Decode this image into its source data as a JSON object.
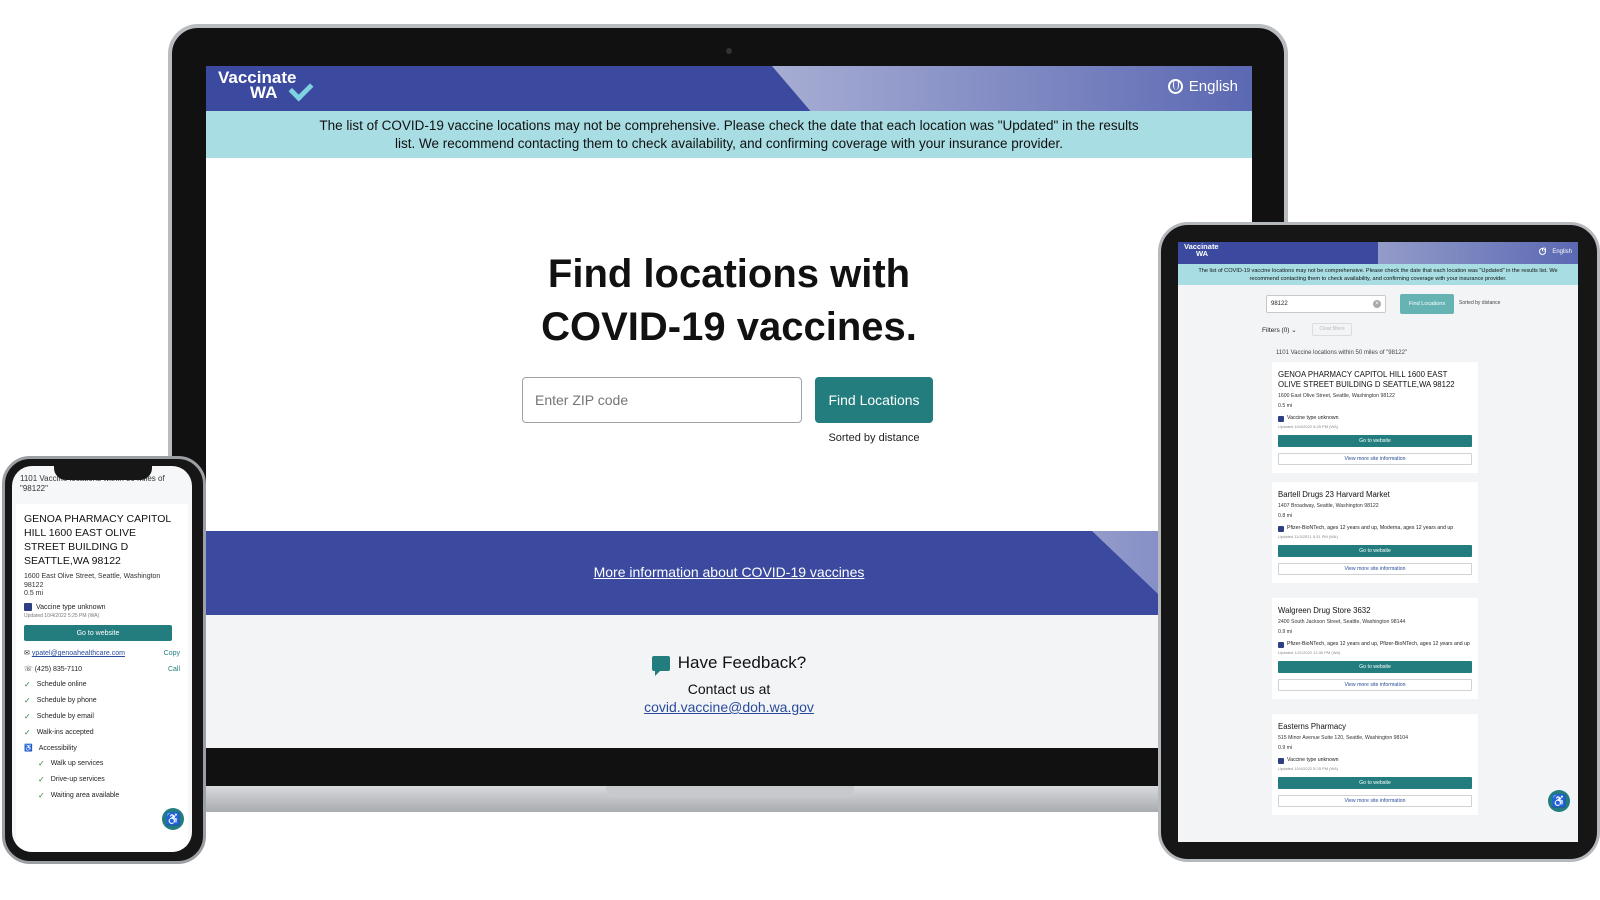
{
  "brand": {
    "logo_line1": "Vaccinate",
    "logo_line2": "WA",
    "language": "English",
    "icon_globe": "globe-icon",
    "icon_check": "check-icon",
    "colors": {
      "primary": "#3b4a9e",
      "banner": "#a8dde3",
      "button": "#237d7e"
    }
  },
  "laptop": {
    "banner": "The list of COVID-19 vaccine locations may not be comprehensive. Please check the date that each location was \"Updated\" in the results list. We recommend contacting them to check availability, and confirming coverage with your insurance provider.",
    "title_line1": "Find locations with",
    "title_line2": "COVID-19 vaccines.",
    "zip_placeholder": "Enter ZIP code",
    "find_button": "Find Locations",
    "sorted": "Sorted by distance",
    "more_info_link": "More information about COVID-19 vaccines",
    "feedback_title": "Have Feedback?",
    "feedback_contact": "Contact us at",
    "feedback_email": "covid.vaccine@doh.wa.gov"
  },
  "phone": {
    "result_count": "1101 Vaccine locations within 50 miles of \"98122\"",
    "card": {
      "name": "GENOA PHARMACY CAPITOL HILL 1600 EAST OLIVE STREET BUILDING D SEATTLE,WA 98122",
      "address": "1600 East Olive Street, Seattle, Washington 98122",
      "distance": "0.5 mi",
      "vaccine_type": "Vaccine type unknown",
      "updated": "Updated 10/4/2022 5:25 PM (WA)",
      "go_button": "Go to website",
      "email": "ypatel@genoahealthcare.com",
      "copy": "Copy",
      "phone": "(425) 835-7110",
      "call": "Call",
      "features": [
        "Schedule online",
        "Schedule by phone",
        "Schedule by email",
        "Walk-ins accepted"
      ],
      "accessibility_label": "Accessibility",
      "accessibility_items": [
        "Walk up services",
        "Drive-up services",
        "Waiting area available"
      ]
    },
    "accessibility_menu": "Accessibility Menu"
  },
  "tablet": {
    "banner": "The list of COVID-19 vaccine locations may not be comprehensive. Please check the date that each location was \"Updated\" in the results list. We recommend contacting them to check availability, and confirming coverage with your insurance provider.",
    "search_value": "98122",
    "find_button": "Find Locations",
    "sorted": "Sorted by distance",
    "filters": "Filters (0)",
    "clear_filters": "Clear filters",
    "result_count": "1101 Vaccine locations within 50 miles of \"98122\"",
    "go_button": "Go to website",
    "more_button": "View more site information",
    "cards": [
      {
        "name": "GENOA PHARMACY CAPITOL HILL 1600 EAST OLIVE STREET BUILDING D SEATTLE,WA 98122",
        "address": "1600 East Olive Street, Seattle, Washington 98122",
        "distance": "0.5 mi",
        "vaccine": "Vaccine type unknown",
        "updated": "Updated 10/4/2022 5:25 PM (WA)"
      },
      {
        "name": "Bartell Drugs 23 Harvard Market",
        "address": "1407 Broadway, Seattle, Washington 98122",
        "distance": "0.8 mi",
        "vaccine": "Pfizer-BioNTech, ages 12 years and up, Moderna, ages 12 years and up",
        "updated": "Updated 11/3/2021 5:31 PM (WA)"
      },
      {
        "name": "Walgreen Drug Store 3632",
        "address": "2400 South Jackson Street, Seattle, Washington 98144",
        "distance": "0.9 mi",
        "vaccine": "Pfizer-BioNTech, ages 12 years and up, Pfizer-BioNTech, ages 12 years and up",
        "updated": "Updated 1/21/2022 12:30 PM (WA)"
      },
      {
        "name": "Easterns Pharmacy",
        "address": "515 Minor Avenue Suite 120, Seattle, Washington 98104",
        "distance": "0.9 mi",
        "vaccine": "Vaccine type unknown",
        "updated": "Updated 10/4/2022 5:25 PM (WA)"
      }
    ],
    "accessibility_menu": "Accessibility Menu"
  }
}
